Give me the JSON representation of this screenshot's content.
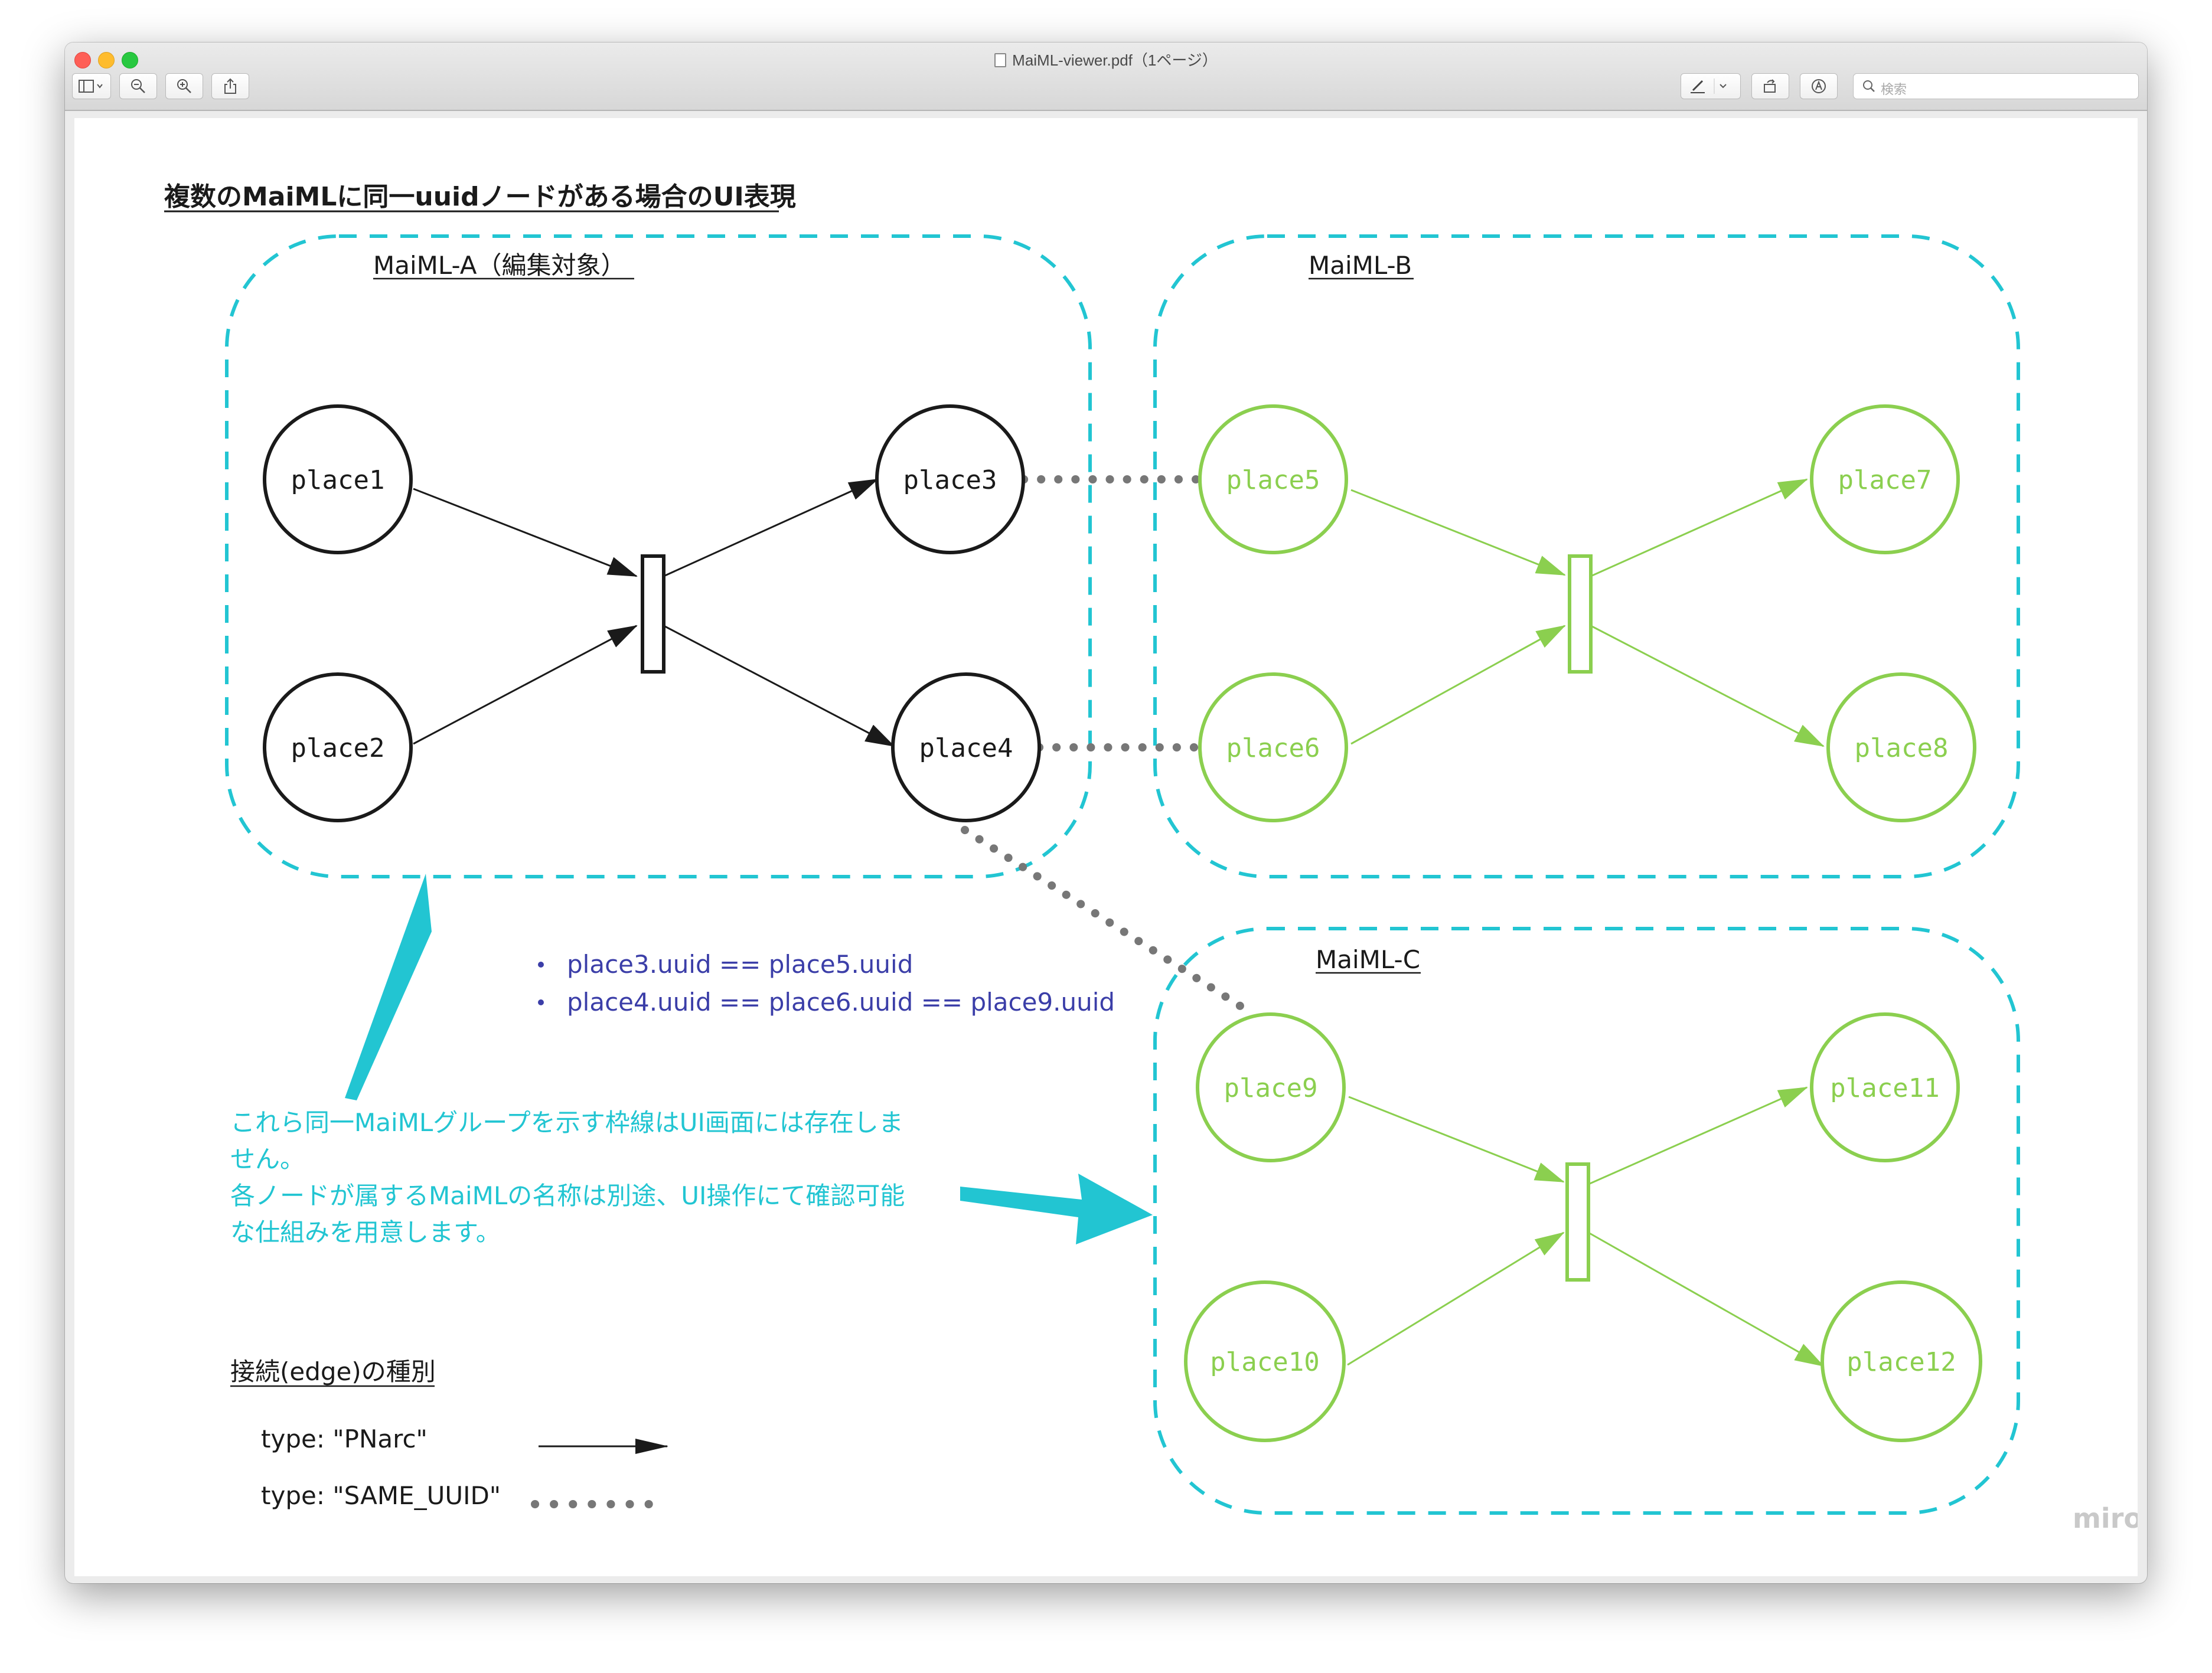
{
  "window": {
    "title": "MaiML-viewer.pdf（1ページ）",
    "search_placeholder": "検索"
  },
  "toolbar": {
    "sidebar_icon": "sidebar-icon",
    "zoom_out_icon": "zoom-out-icon",
    "zoom_in_icon": "zoom-in-icon",
    "share_icon": "share-icon",
    "markup_icon": "pen-icon",
    "rotate_icon": "rotate-icon",
    "annotate_icon": "markup-circle-icon",
    "search_icon": "search-icon"
  },
  "diagram": {
    "heading": "複数のMaiMLに同一uuidノードがある場合のUI表現",
    "groups": {
      "a": {
        "label": "MaiML-A（編集対象）"
      },
      "b": {
        "label": "MaiML-B"
      },
      "c": {
        "label": "MaiML-C"
      }
    },
    "nodes": {
      "place1": "place1",
      "place2": "place2",
      "place3": "place3",
      "place4": "place4",
      "place5": "place5",
      "place6": "place6",
      "place7": "place7",
      "place8": "place8",
      "place9": "place9",
      "place10": "place10",
      "place11": "place11",
      "place12": "place12"
    },
    "bullets": [
      "place3.uuid == place5.uuid",
      "place4.uuid == place6.uuid == place9.uuid"
    ],
    "note_lines": [
      "これら同一MaiMLグループを示す枠線はUI画面には存在しま",
      "せん。",
      "各ノードが属するMaiMLの名称は別途、UI操作にて確認可能",
      "な仕組みを用意します。"
    ],
    "legend": {
      "title": "接続(edge)の種別",
      "pnarc": "type: \"PNarc\"",
      "same_uuid": "type: \"SAME_UUID\""
    },
    "watermark": "miro",
    "colors": {
      "black": "#1a1a1a",
      "green": "#8bcf4f",
      "cyan": "#22c5d2",
      "blue_text": "#3b3ea8",
      "dots": "#777777"
    }
  }
}
